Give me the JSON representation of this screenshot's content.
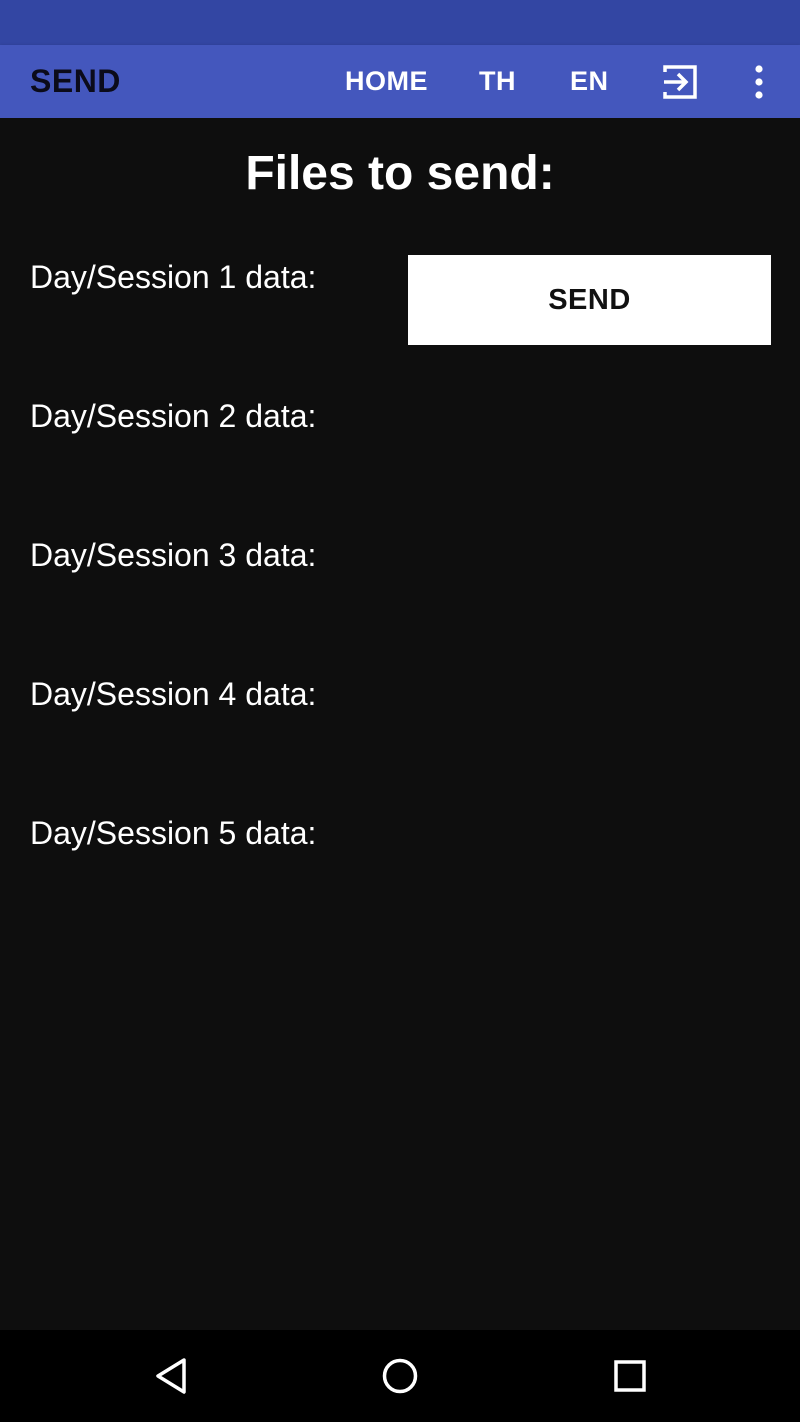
{
  "app_bar": {
    "title": "SEND",
    "actions": {
      "home": "HOME",
      "th": "TH",
      "en": "EN"
    },
    "icons": {
      "exit": "exit-to-app-icon",
      "more": "more-vert-icon"
    }
  },
  "main": {
    "title": "Files to send:",
    "rows": [
      {
        "label": "Day/Session 1 data:",
        "button": "SEND"
      },
      {
        "label": "Day/Session 2 data:"
      },
      {
        "label": "Day/Session 3 data:"
      },
      {
        "label": "Day/Session 4 data:"
      },
      {
        "label": "Day/Session 5 data:"
      }
    ]
  },
  "nav_bar": {
    "icons": [
      "back-icon",
      "home-icon",
      "recents-icon"
    ]
  },
  "colors": {
    "status_bar": "#3346a3",
    "app_bar": "#4457bd",
    "background": "#0e0e0e",
    "button": "#ffffff"
  }
}
